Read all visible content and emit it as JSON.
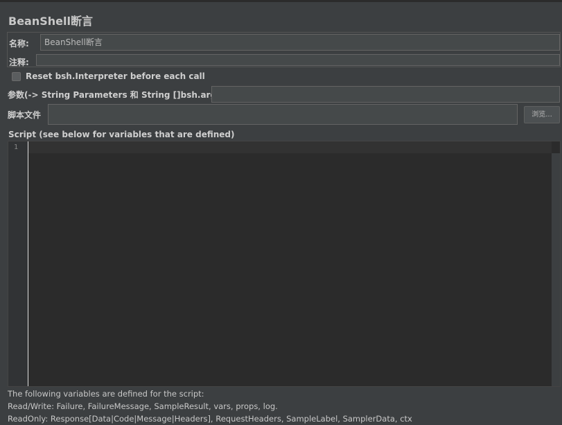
{
  "panel": {
    "title": "BeanShell断言"
  },
  "name_field": {
    "label": "名称:",
    "value": "BeanShell断言"
  },
  "comment_field": {
    "label": "注释:",
    "value": ""
  },
  "reset_interpreter": {
    "label": "Reset bsh.Interpreter before each call",
    "checked": false
  },
  "parameters_field": {
    "label": "参数(-> String Parameters 和 String []bsh.args)",
    "value": ""
  },
  "script_file_field": {
    "label": "脚本文件",
    "value": "",
    "browse_label": "浏览..."
  },
  "script": {
    "label": "Script (see below for variables that are defined)",
    "line_numbers": [
      "1"
    ],
    "content": ""
  },
  "variables_info": {
    "line1": "The following variables are defined for the script:",
    "line2": "Read/Write: Failure, FailureMessage, SampleResult, vars, props, log.",
    "line3": "ReadOnly: Response[Data|Code|Message|Headers], RequestHeaders, SampleLabel, SamplerData, ctx"
  },
  "colors": {
    "background": "#3c3f41",
    "editor_background": "#2b2b2b",
    "field_background": "#45494a"
  }
}
